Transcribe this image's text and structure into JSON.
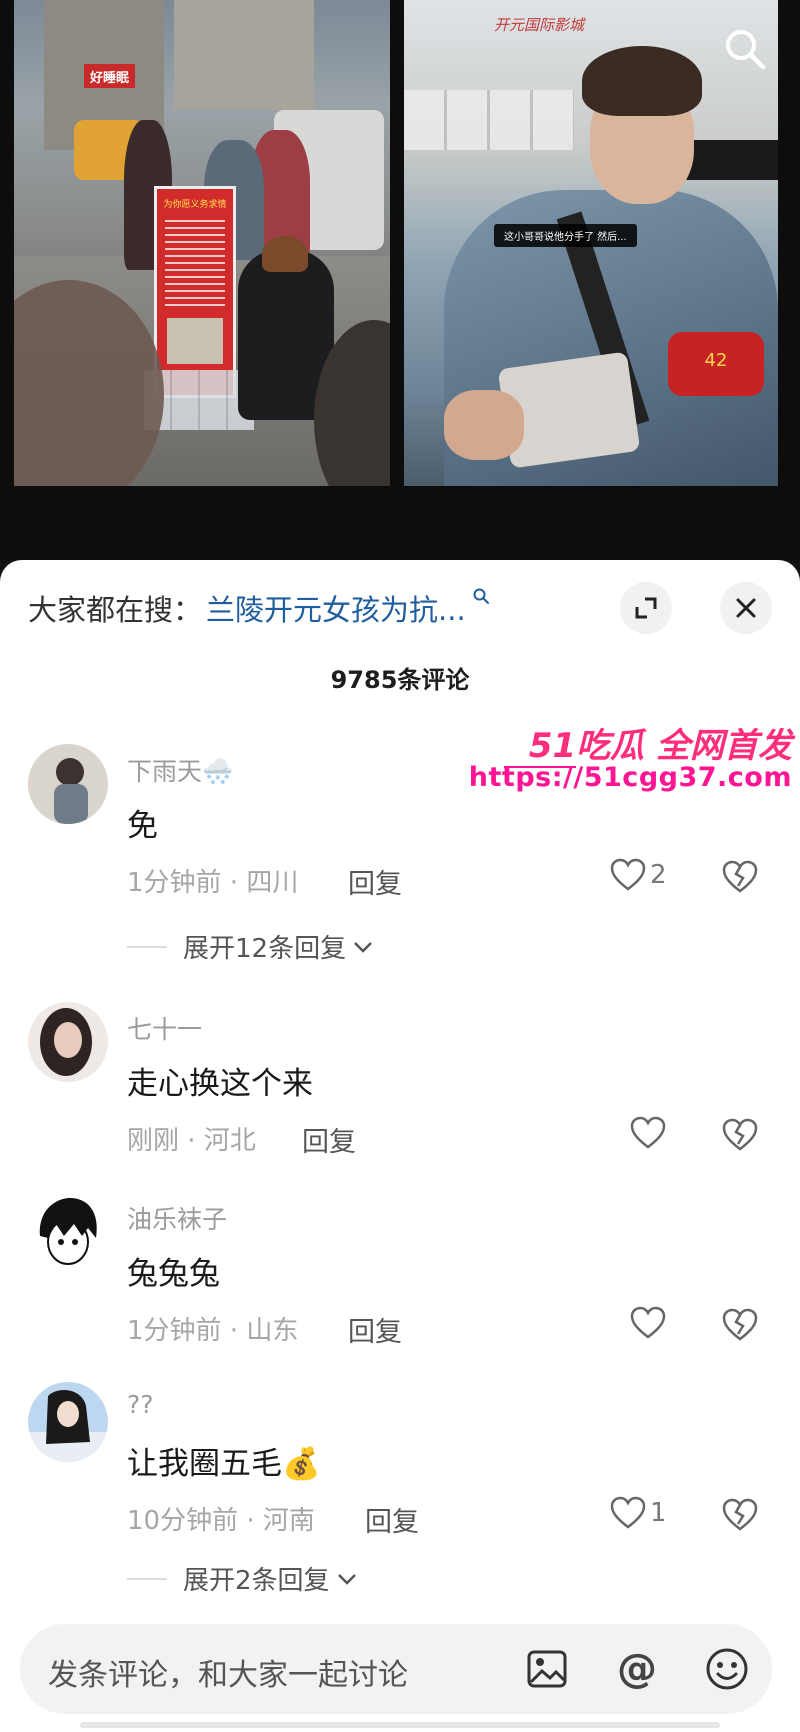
{
  "video": {
    "right_subtitle": "这小哥哥说他分手了 然后...",
    "banner_title": "为你愿义务求情",
    "mall_sign": "开元国际影城",
    "left_shop_sign": "好睡眠",
    "armband_number": "42"
  },
  "sheet": {
    "hot_prefix": "大家都在搜：",
    "hot_query": "兰陵开元女孩为抗...",
    "comment_count": "9785条评论"
  },
  "watermark": {
    "brand": "51吃瓜 全网首发",
    "url": "https://51cgg37.com"
  },
  "comments": [
    {
      "user": "下雨天🌨️",
      "text": "免",
      "time": "1分钟前",
      "location": "四川",
      "reply_label": "回复",
      "likes": "2",
      "expand_label": "展开12条回复"
    },
    {
      "user": "七十一",
      "text": "走心换这个来",
      "time": "刚刚",
      "location": "河北",
      "reply_label": "回复",
      "likes": ""
    },
    {
      "user": "油乐袜子",
      "text": "兔兔兔",
      "time": "1分钟前",
      "location": "山东",
      "reply_label": "回复",
      "likes": ""
    },
    {
      "user": "??",
      "text": "让我圈五毛💰",
      "time": "10分钟前",
      "location": "河南",
      "reply_label": "回复",
      "likes": "1",
      "expand_label": "展开2条回复"
    }
  ],
  "composer": {
    "placeholder": "发条评论，和大家一起讨论",
    "at_symbol": "@"
  },
  "colors": {
    "link": "#1f5e9e",
    "watermark": "#ff1493",
    "sheet_bg": "#ffffff"
  },
  "icons": [
    "search-icon",
    "expand-icon",
    "close-icon",
    "heart-icon",
    "broken-heart-icon",
    "chevron-down-icon",
    "image-icon",
    "emoji-icon"
  ]
}
